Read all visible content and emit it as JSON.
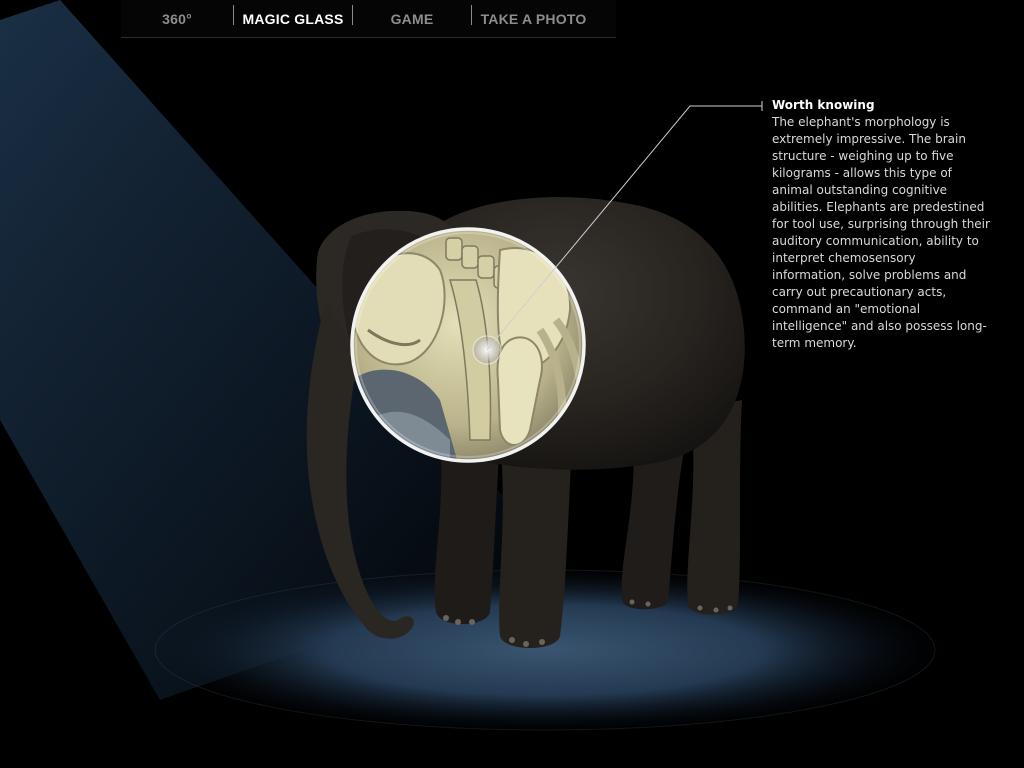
{
  "nav": {
    "items": [
      {
        "id": "360",
        "label": "360°",
        "active": false
      },
      {
        "id": "magic-glass",
        "label": "MAGIC GLASS",
        "active": true
      },
      {
        "id": "game",
        "label": "GAME",
        "active": false
      },
      {
        "id": "take-a-photo",
        "label": "TAKE A PHOTO",
        "active": false
      }
    ]
  },
  "info": {
    "title": "Worth knowing",
    "body": "The elephant's morphology is extremely impressive. The brain structure - weighing up to five kilograms - allows this type of animal outstanding cognitive abilities. Elephants are predestined for tool use, surprising through their auditory communication, ability to interpret chemosensory information, solve problems and carry out precautionary acts, command an \"emotional intelligence\" and also possess long-term memory."
  },
  "colors": {
    "background": "#000000",
    "spotlight": "#1c3550",
    "nav_active": "#ffffff",
    "nav_inactive": "#8d8d8d",
    "elephant_skin": "#2a2724",
    "bone": "#d8d2a8"
  }
}
